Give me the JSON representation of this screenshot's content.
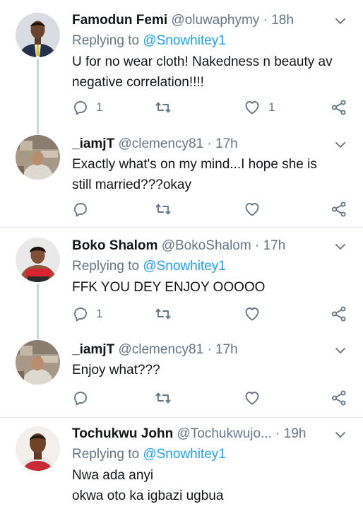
{
  "tweets": [
    {
      "name": "Famodun Femi",
      "handle": "@oluwaphymy",
      "time": "18h",
      "replying_label": "Replying to",
      "replying_to": "@Snowhitey1",
      "lines": [
        "U for no wear cloth! Nakedness n beauty av",
        "negative correlation!!!!"
      ],
      "reply_count": "1",
      "retweet_count": "",
      "like_count": "1"
    },
    {
      "name": "_iamjT",
      "handle": "@clemency81",
      "time": "17h",
      "lines": [
        "Exactly what's on my mind...I hope she is",
        "still married???okay"
      ],
      "reply_count": "",
      "retweet_count": "",
      "like_count": ""
    },
    {
      "name": "Boko Shalom",
      "handle": "@BokoShalom",
      "time": "17h",
      "replying_label": "Replying to",
      "replying_to": "@Snowhitey1",
      "lines": [
        "FFK YOU DEY ENJOY OOOOO"
      ],
      "reply_count": "1",
      "retweet_count": "",
      "like_count": ""
    },
    {
      "name": "_iamjT",
      "handle": "@clemency81",
      "time": "17h",
      "lines": [
        "Enjoy what???"
      ],
      "reply_count": "",
      "retweet_count": "",
      "like_count": ""
    },
    {
      "name": "Tochukwu John",
      "handle": "@Tochukwujo...",
      "time": "19h",
      "replying_label": "Replying to",
      "replying_to": "@Snowhitey1",
      "lines": [
        "Nwa ada anyi",
        "okwa oto ka igbazi ugbua"
      ]
    }
  ],
  "separator": "·",
  "icons": {
    "reply": "reply-icon",
    "retweet": "retweet-icon",
    "like": "heart-icon",
    "share": "share-icon",
    "menu": "chevron-down-icon"
  },
  "colors": {
    "text": "#14171a",
    "secondary": "#657786",
    "mention": "#1da1f2",
    "thread_line": "#ccd6dd",
    "divider": "#e1e8ed"
  }
}
